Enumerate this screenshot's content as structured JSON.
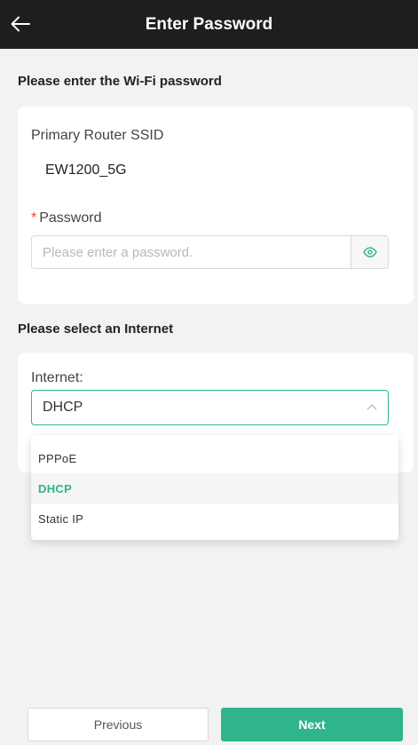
{
  "header": {
    "title": "Enter Password",
    "back_icon": "arrow-left-icon"
  },
  "wifi_section": {
    "title": "Please enter the Wi-Fi password",
    "ssid_label": "Primary Router SSID",
    "ssid_value": "EW1200_5G",
    "password_required_mark": "*",
    "password_label": "Password",
    "password_value": "",
    "password_placeholder": "Please enter a password.",
    "eye_icon": "eye-icon"
  },
  "internet_section": {
    "title": "Please select an Internet",
    "internet_label": "Internet:",
    "selected_value": "DHCP",
    "chevron_icon": "chevron-up-icon",
    "options": [
      {
        "label": "PPPoE",
        "selected": false
      },
      {
        "label": "DHCP",
        "selected": true
      },
      {
        "label": "Static IP",
        "selected": false
      }
    ]
  },
  "footer": {
    "previous_label": "Previous",
    "next_label": "Next"
  },
  "colors": {
    "accent": "#2fb48c",
    "header_bg": "#1e1e1e",
    "required": "#e64545",
    "page_bg": "#f2f2f2"
  }
}
